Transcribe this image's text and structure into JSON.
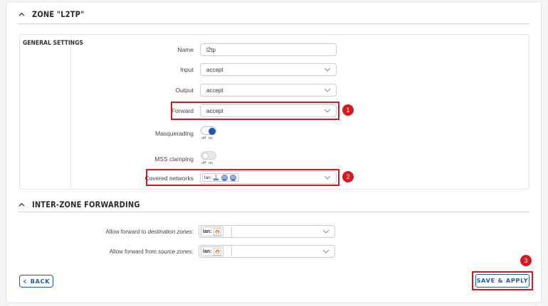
{
  "zone": {
    "title": "ZONE \"L2TP\""
  },
  "general": {
    "section_label": "GENERAL SETTINGS",
    "name": {
      "label": "Name",
      "value": "l2tp"
    },
    "input": {
      "label": "Input",
      "value": "accept"
    },
    "output": {
      "label": "Output",
      "value": "accept"
    },
    "forward": {
      "label": "Forward",
      "value": "accept"
    },
    "masquerading": {
      "label": "Masquerading",
      "off": "off",
      "on": "on",
      "state": true
    },
    "mss": {
      "label": "MSS clamping",
      "off": "off",
      "on": "on",
      "state": false
    },
    "covered": {
      "label": "Covered networks",
      "chip_label": "lan:"
    }
  },
  "interzone": {
    "title": "INTER-ZONE FORWARDING",
    "to": {
      "prefix": "Allow forward to ",
      "emph": "destination zones",
      "suffix": ":",
      "chip_label": "lan:"
    },
    "from": {
      "prefix": "Allow forward from ",
      "emph": "source zones",
      "suffix": ":",
      "chip_label": "lan:"
    }
  },
  "buttons": {
    "back": "BACK",
    "save": "SAVE & APPLY"
  },
  "badges": {
    "b1": "1",
    "b2": "2",
    "b3": "3"
  },
  "colors": {
    "accent": "#1e5aa8",
    "highlight": "#d7191f"
  },
  "icons": [
    "chevron-up-icon",
    "chevron-down-icon",
    "chevron-left-icon",
    "network-icon",
    "router-icon"
  ]
}
